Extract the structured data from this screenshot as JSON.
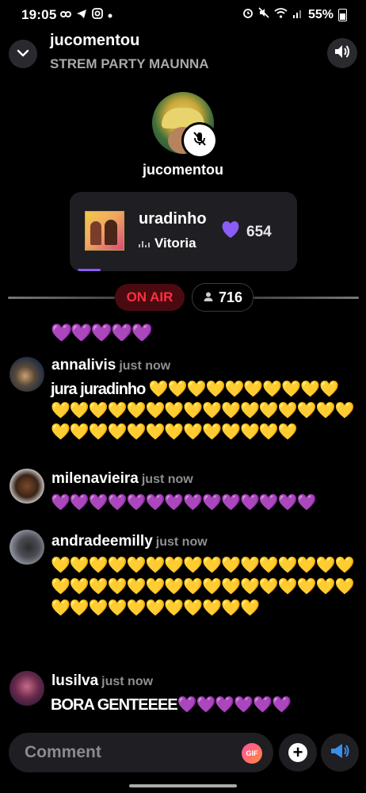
{
  "status_bar": {
    "time": "19:05",
    "battery": "55%",
    "left_icons": [
      "link-icon",
      "telegram-icon",
      "instagram-icon",
      "dot-icon"
    ],
    "right_icons": [
      "alarm-icon",
      "mute-icon",
      "wifi-icon",
      "signal-icon",
      "battery-icon"
    ]
  },
  "header": {
    "host_name": "jucomentou",
    "room_name": "STREM PARTY MAUNNA"
  },
  "host": {
    "name": "jucomentou",
    "muted": true
  },
  "now_playing": {
    "title": "uradinho",
    "artist": "Vitoria",
    "likes": "654",
    "progress_fraction": 0.1
  },
  "live": {
    "badge": "ON AIR",
    "listeners": "716"
  },
  "chat": {
    "partial_hearts": "💜💜💜💜💜",
    "comments": [
      {
        "user": "annalivis",
        "time": "just now",
        "text_prefix": "jura juradinho ",
        "hearts": "💛💛💛💛💛💛💛💛💛💛💛💛💛💛💛💛💛💛💛💛💛💛💛💛💛💛💛💛💛💛💛💛💛💛💛💛💛💛💛"
      },
      {
        "user": "milenavieira",
        "time": "just now",
        "text_prefix": "",
        "hearts": "💜💜💜💜💜💜💜💜💜💜💜💜💜💜"
      },
      {
        "user": "andradeemilly",
        "time": "just now",
        "text_prefix": "",
        "hearts": "💛💛💛💛💛💛💛💛💛💛💛💛💛💛💛💛💛💛💛💛💛💛💛💛💛💛💛💛💛💛💛💛💛💛💛💛💛💛💛💛💛💛💛"
      },
      {
        "user": "lusilva",
        "time": "just now",
        "text_prefix": "BORA GENTEEEE",
        "hearts": "💜💜💜💜💜💜"
      }
    ]
  },
  "composer": {
    "placeholder": "Comment",
    "gif_label": "GIF"
  },
  "colors": {
    "accent_purple": "#8b5cf6",
    "on_air_red": "#ff3040",
    "yellow_heart": "#f7c51b",
    "purple_heart": "#8a3fe0"
  }
}
